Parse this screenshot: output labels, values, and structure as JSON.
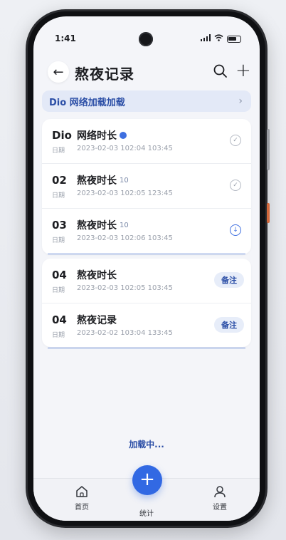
{
  "status": {
    "time": "1:41"
  },
  "header": {
    "title": "熬夜记录"
  },
  "banner": {
    "text": "Dio 网络加载加载"
  },
  "list_group1": [
    {
      "num": "Dio",
      "title": "网络时长",
      "tag": "",
      "date_label": "日期",
      "date": "2023-02-03 102:04 103:45"
    },
    {
      "num": "02",
      "title": "熬夜时长",
      "tag": "10",
      "date_label": "日期",
      "date": "2023-02-03 102:05 123:45"
    },
    {
      "num": "03",
      "title": "熬夜时长",
      "tag": "10",
      "date_label": "日期",
      "date": "2023-02-03 102:06 103:45"
    }
  ],
  "list_group2": [
    {
      "num": "04",
      "title": "熬夜时长",
      "date_label": "日期",
      "date": "2023-02-03 102:05 103:45",
      "action": "备注"
    },
    {
      "num": "04",
      "title": "熬夜记录",
      "date_label": "日期",
      "date": "2023-02-02 103:04 133:45",
      "action": "备注"
    }
  ],
  "loading": "加载中...",
  "tabbar": {
    "home": "首页",
    "stats": "统计",
    "settings": "设置"
  },
  "colors": {
    "accent": "#3269e3",
    "banner_bg": "#e3e9f7"
  }
}
